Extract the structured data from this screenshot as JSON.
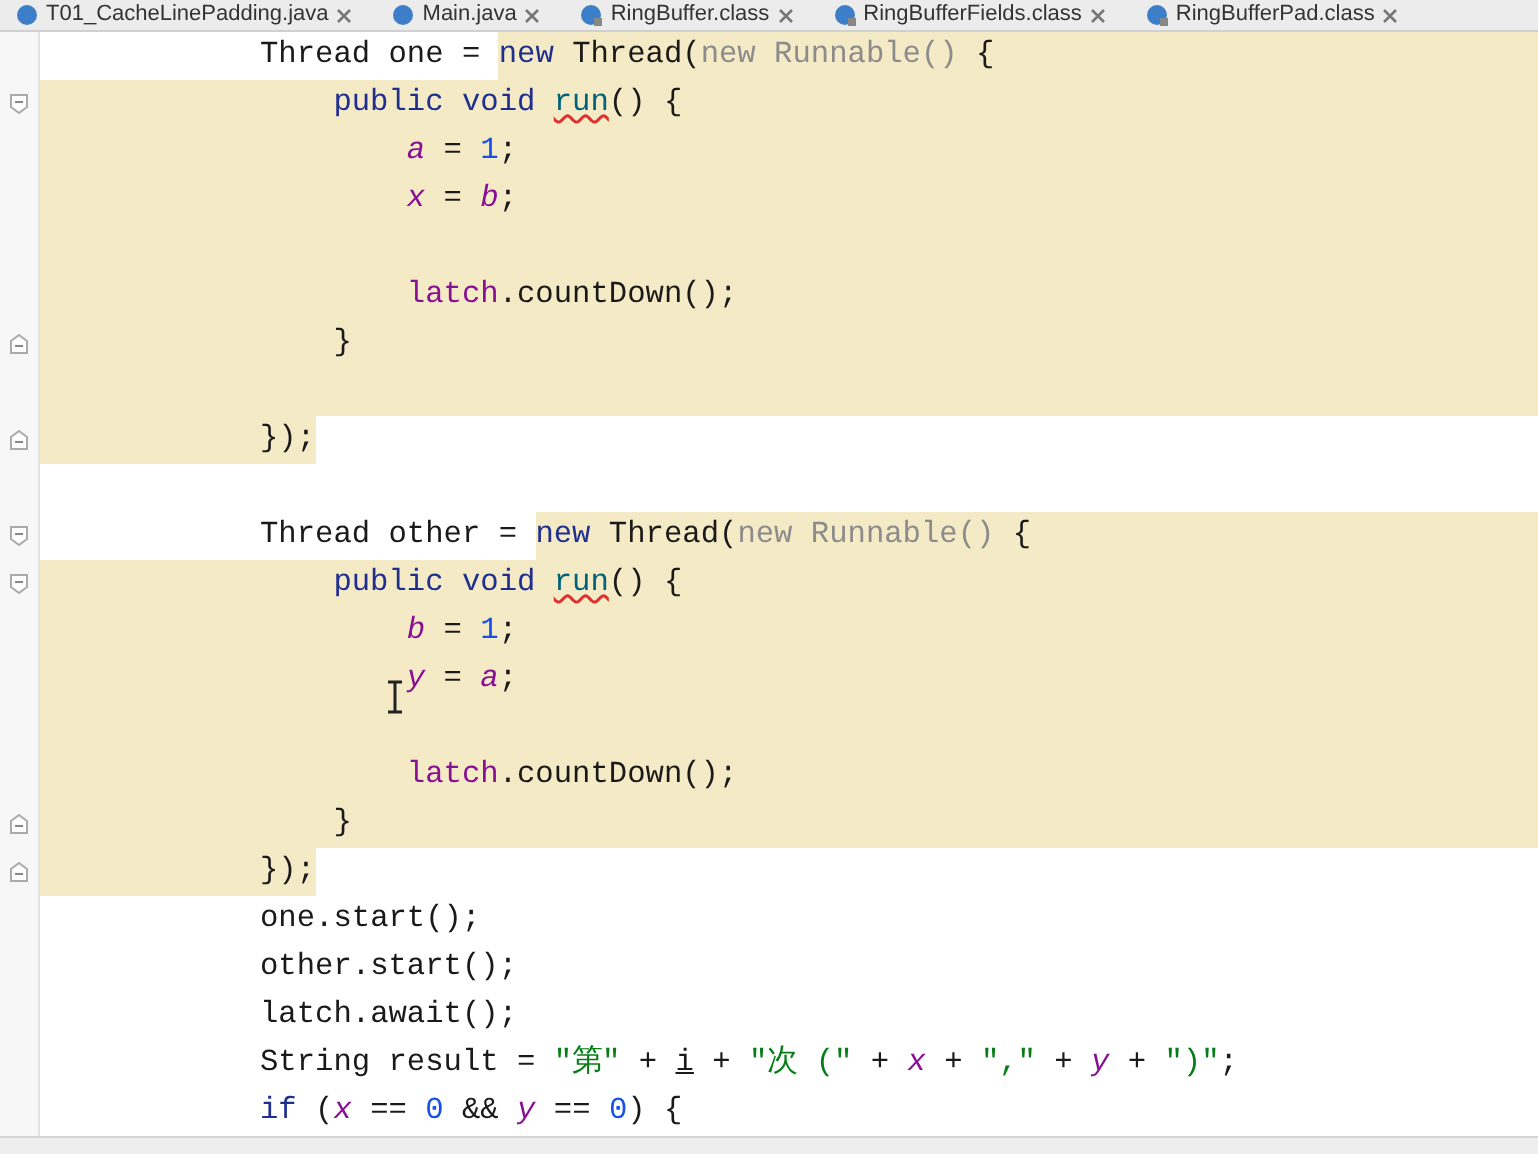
{
  "tabs": [
    {
      "label": "T01_CacheLinePadding.java",
      "kind": "java"
    },
    {
      "label": "Main.java",
      "kind": "java"
    },
    {
      "label": "RingBuffer.class",
      "kind": "class"
    },
    {
      "label": "RingBufferFields.class",
      "kind": "class"
    },
    {
      "label": "RingBufferPad.class",
      "kind": "class"
    }
  ],
  "lines": [
    {
      "kind": "tail",
      "fold_start": false,
      "fold_end": false,
      "tokens": [
        {
          "text": "Thread one = ",
          "kind": "plain",
          "highlighted": false
        },
        {
          "text": "new",
          "kind": "keyword",
          "highlighted": true
        },
        {
          "text": " Thread(",
          "kind": "plain",
          "highlighted": true
        },
        {
          "text": "new Runnable()",
          "kind": "dim",
          "highlighted": true
        },
        {
          "text": " {",
          "kind": "plain",
          "highlighted": true
        }
      ]
    },
    {
      "kind": "full",
      "fold_start": true,
      "fold_end": false,
      "tokens": [
        {
          "text": "    public void ",
          "kind": "keyword"
        },
        {
          "text": "run",
          "kind": "method"
        },
        {
          "text": "() {",
          "kind": "plain"
        }
      ]
    },
    {
      "kind": "full",
      "fold_start": false,
      "fold_end": false,
      "tokens": [
        {
          "text": "        a",
          "kind": "field"
        },
        {
          "text": " = ",
          "kind": "plain"
        },
        {
          "text": "1",
          "kind": "number"
        },
        {
          "text": ";",
          "kind": "plain"
        }
      ]
    },
    {
      "kind": "full",
      "fold_start": false,
      "fold_end": false,
      "tokens": [
        {
          "text": "        x",
          "kind": "field"
        },
        {
          "text": " = ",
          "kind": "plain"
        },
        {
          "text": "b",
          "kind": "field"
        },
        {
          "text": ";",
          "kind": "plain"
        }
      ]
    },
    {
      "kind": "full",
      "fold_start": false,
      "fold_end": false
    },
    {
      "kind": "full",
      "fold_start": false,
      "fold_end": false,
      "tokens": [
        {
          "text": "        latch",
          "kind": "member"
        },
        {
          "text": ".countDown();",
          "kind": "plain"
        }
      ]
    },
    {
      "kind": "full",
      "fold_start": false,
      "fold_end": true,
      "tokens": [
        {
          "text": "    }",
          "kind": "plain"
        }
      ]
    },
    {
      "kind": "full",
      "fold_start": false,
      "fold_end": false
    },
    {
      "kind": "text",
      "fold_start": false,
      "fold_end": true,
      "tokens": [
        {
          "text": "});",
          "kind": "plain"
        }
      ]
    },
    {
      "kind": "plain",
      "fold_start": false,
      "fold_end": false
    },
    {
      "kind": "tail",
      "fold_start": true,
      "fold_end": false,
      "tokens": [
        {
          "text": "Thread other = ",
          "kind": "plain",
          "highlighted": false
        },
        {
          "text": "new",
          "kind": "keyword",
          "highlighted": true
        },
        {
          "text": " Thread(",
          "kind": "plain",
          "highlighted": true
        },
        {
          "text": "new Runnable()",
          "kind": "dim",
          "highlighted": true
        },
        {
          "text": " {",
          "kind": "plain",
          "highlighted": true
        }
      ]
    },
    {
      "kind": "full",
      "fold_start": true,
      "fold_end": false,
      "tokens": [
        {
          "text": "    public void ",
          "kind": "keyword"
        },
        {
          "text": "run",
          "kind": "method"
        },
        {
          "text": "() {",
          "kind": "plain"
        }
      ]
    },
    {
      "kind": "full",
      "fold_start": false,
      "fold_end": false,
      "tokens": [
        {
          "text": "        b",
          "kind": "field"
        },
        {
          "text": " = ",
          "kind": "plain"
        },
        {
          "text": "1",
          "kind": "number"
        },
        {
          "text": ";",
          "kind": "plain"
        }
      ]
    },
    {
      "kind": "full",
      "fold_start": false,
      "fold_end": false,
      "tokens": [
        {
          "text": "        y",
          "kind": "field"
        },
        {
          "text": " = ",
          "kind": "plain"
        },
        {
          "text": "a",
          "kind": "field"
        },
        {
          "text": ";",
          "kind": "plain"
        }
      ]
    },
    {
      "kind": "full",
      "fold_start": false,
      "fold_end": false
    },
    {
      "kind": "full",
      "fold_start": false,
      "fold_end": false,
      "tokens": [
        {
          "text": "        latch",
          "kind": "member"
        },
        {
          "text": ".countDown();",
          "kind": "plain"
        }
      ]
    },
    {
      "kind": "full",
      "fold_start": false,
      "fold_end": true,
      "tokens": [
        {
          "text": "    }",
          "kind": "plain"
        }
      ]
    },
    {
      "kind": "text",
      "fold_start": false,
      "fold_end": true,
      "tokens": [
        {
          "text": "});",
          "kind": "plain"
        }
      ]
    },
    {
      "kind": "plain",
      "fold_start": false,
      "fold_end": false,
      "tokens": [
        {
          "text": "one.start();",
          "kind": "plain"
        }
      ]
    },
    {
      "kind": "plain",
      "fold_start": false,
      "fold_end": false,
      "tokens": [
        {
          "text": "other.start();",
          "kind": "plain"
        }
      ]
    },
    {
      "kind": "plain",
      "fold_start": false,
      "fold_end": false,
      "tokens": [
        {
          "text": "latch.await();",
          "kind": "plain"
        }
      ]
    },
    {
      "kind": "plain",
      "fold_start": false,
      "fold_end": false,
      "tokens": [
        {
          "text": "String result = ",
          "kind": "plain"
        },
        {
          "text": "\"第\"",
          "kind": "string"
        },
        {
          "text": " + ",
          "kind": "plain"
        },
        {
          "text": "i",
          "kind": "underlined"
        },
        {
          "text": " + ",
          "kind": "plain"
        },
        {
          "text": "\"次 (\"",
          "kind": "string"
        },
        {
          "text": " + ",
          "kind": "plain"
        },
        {
          "text": "x",
          "kind": "field"
        },
        {
          "text": " + ",
          "kind": "plain"
        },
        {
          "text": "\",\"",
          "kind": "string"
        },
        {
          "text": " + ",
          "kind": "plain"
        },
        {
          "text": "y",
          "kind": "field"
        },
        {
          "text": " + ",
          "kind": "plain"
        },
        {
          "text": "\")\"",
          "kind": "string"
        },
        {
          "text": ";",
          "kind": "plain"
        }
      ]
    },
    {
      "kind": "plain",
      "fold_start": false,
      "fold_end": false,
      "tokens": [
        {
          "text": "if",
          "kind": "keyword"
        },
        {
          "text": " (",
          "kind": "plain"
        },
        {
          "text": "x",
          "kind": "field"
        },
        {
          "text": " == ",
          "kind": "plain"
        },
        {
          "text": "0",
          "kind": "number"
        },
        {
          "text": " && ",
          "kind": "plain"
        },
        {
          "text": "y",
          "kind": "field"
        },
        {
          "text": " == ",
          "kind": "plain"
        },
        {
          "text": "0",
          "kind": "number"
        },
        {
          "text": ") {",
          "kind": "plain"
        }
      ]
    }
  ]
}
